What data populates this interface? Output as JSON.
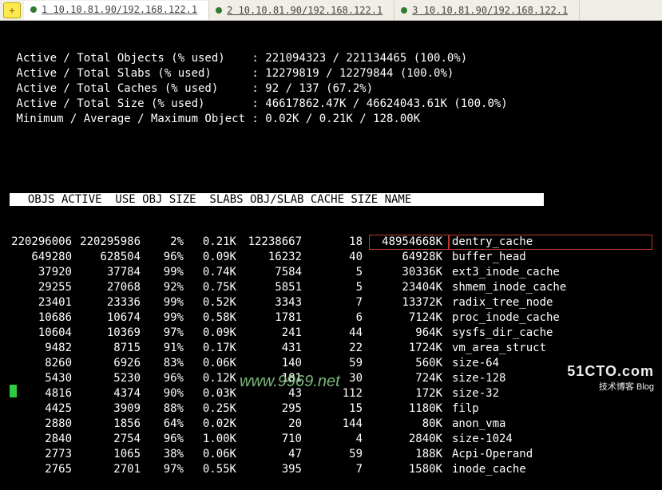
{
  "tabs": [
    {
      "num": "1",
      "label": "10.10.81.90/192.168.122.1",
      "active": true
    },
    {
      "num": "2",
      "label": "10.10.81.90/192.168.122.1",
      "active": false
    },
    {
      "num": "3",
      "label": "10.10.81.90/192.168.122.1",
      "active": false
    }
  ],
  "summary": [
    " Active / Total Objects (% used)    : 221094323 / 221134465 (100.0%)",
    " Active / Total Slabs (% used)      : 12279819 / 12279844 (100.0%)",
    " Active / Total Caches (% used)     : 92 / 137 (67.2%)",
    " Active / Total Size (% used)       : 46617862.47K / 46624043.61K (100.0%)",
    " Minimum / Average / Maximum Object : 0.02K / 0.21K / 128.00K"
  ],
  "header": "  OBJS ACTIVE  USE OBJ SIZE  SLABS OBJ/SLAB CACHE SIZE NAME                   ",
  "chart_data": {
    "type": "table",
    "columns": [
      "OBJS",
      "ACTIVE",
      "USE",
      "OBJ SIZE",
      "SLABS",
      "OBJ/SLAB",
      "CACHE SIZE",
      "NAME"
    ],
    "rows": [
      {
        "objs": "220296006",
        "active": "220295986",
        "use": "2%",
        "objsize": "0.21K",
        "slabs": "12238667",
        "objslab": "18",
        "cachesize": "48954668K",
        "name": "dentry_cache",
        "highlight": true
      },
      {
        "objs": "649280",
        "active": "628504",
        "use": "96%",
        "objsize": "0.09K",
        "slabs": "16232",
        "objslab": "40",
        "cachesize": "64928K",
        "name": "buffer_head"
      },
      {
        "objs": "37920",
        "active": "37784",
        "use": "99%",
        "objsize": "0.74K",
        "slabs": "7584",
        "objslab": "5",
        "cachesize": "30336K",
        "name": "ext3_inode_cache"
      },
      {
        "objs": "29255",
        "active": "27068",
        "use": "92%",
        "objsize": "0.75K",
        "slabs": "5851",
        "objslab": "5",
        "cachesize": "23404K",
        "name": "shmem_inode_cache"
      },
      {
        "objs": "23401",
        "active": "23336",
        "use": "99%",
        "objsize": "0.52K",
        "slabs": "3343",
        "objslab": "7",
        "cachesize": "13372K",
        "name": "radix_tree_node"
      },
      {
        "objs": "10686",
        "active": "10674",
        "use": "99%",
        "objsize": "0.58K",
        "slabs": "1781",
        "objslab": "6",
        "cachesize": "7124K",
        "name": "proc_inode_cache"
      },
      {
        "objs": "10604",
        "active": "10369",
        "use": "97%",
        "objsize": "0.09K",
        "slabs": "241",
        "objslab": "44",
        "cachesize": "964K",
        "name": "sysfs_dir_cache"
      },
      {
        "objs": "9482",
        "active": "8715",
        "use": "91%",
        "objsize": "0.17K",
        "slabs": "431",
        "objslab": "22",
        "cachesize": "1724K",
        "name": "vm_area_struct"
      },
      {
        "objs": "8260",
        "active": "6926",
        "use": "83%",
        "objsize": "0.06K",
        "slabs": "140",
        "objslab": "59",
        "cachesize": "560K",
        "name": "size-64"
      },
      {
        "objs": "5430",
        "active": "5230",
        "use": "96%",
        "objsize": "0.12K",
        "slabs": "181",
        "objslab": "30",
        "cachesize": "724K",
        "name": "size-128"
      },
      {
        "objs": "4816",
        "active": "4374",
        "use": "90%",
        "objsize": "0.03K",
        "slabs": "43",
        "objslab": "112",
        "cachesize": "172K",
        "name": "size-32"
      },
      {
        "objs": "4425",
        "active": "3909",
        "use": "88%",
        "objsize": "0.25K",
        "slabs": "295",
        "objslab": "15",
        "cachesize": "1180K",
        "name": "filp"
      },
      {
        "objs": "2880",
        "active": "1856",
        "use": "64%",
        "objsize": "0.02K",
        "slabs": "20",
        "objslab": "144",
        "cachesize": "80K",
        "name": "anon_vma"
      },
      {
        "objs": "2840",
        "active": "2754",
        "use": "96%",
        "objsize": "1.00K",
        "slabs": "710",
        "objslab": "4",
        "cachesize": "2840K",
        "name": "size-1024"
      },
      {
        "objs": "2773",
        "active": "1065",
        "use": "38%",
        "objsize": "0.06K",
        "slabs": "47",
        "objslab": "59",
        "cachesize": "188K",
        "name": "Acpi-Operand"
      },
      {
        "objs": "2765",
        "active": "2701",
        "use": "97%",
        "objsize": "0.55K",
        "slabs": "395",
        "objslab": "7",
        "cachesize": "1580K",
        "name": "inode_cache"
      }
    ]
  },
  "watermark1": {
    "big": "51CTO.com",
    "small": "技术博客        Blog"
  },
  "watermark2": "www.9969.net"
}
